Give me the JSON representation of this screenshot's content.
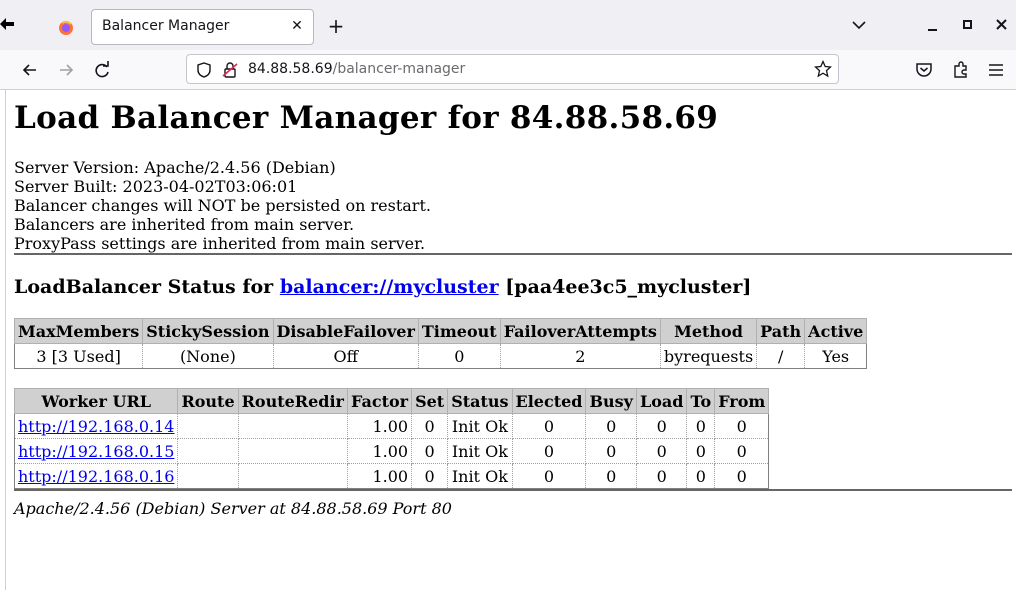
{
  "browser": {
    "tab_title": "Balancer Manager",
    "url_host": "84.88.58.69",
    "url_path": "/balancer-manager",
    "icons": [
      "firefox-icon",
      "close-icon",
      "plus-icon",
      "chevron-down-icon",
      "minimize-icon",
      "maximize-icon",
      "window-close-icon",
      "back-arrow-icon",
      "forward-arrow-icon",
      "reload-icon",
      "shield-icon",
      "lock-icon",
      "star-icon",
      "pocket-icon",
      "extensions-icon",
      "menu-icon"
    ]
  },
  "page": {
    "title": "Load Balancer Manager for 84.88.58.69",
    "info": [
      "Server Version: Apache/2.4.56 (Debian)",
      "Server Built: 2023-04-02T03:06:01",
      "Balancer changes will NOT be persisted on restart.",
      "Balancers are inherited from main server.",
      "ProxyPass settings are inherited from main server."
    ],
    "lb_prefix": "LoadBalancer Status for ",
    "lb_link": "balancer://mycluster",
    "lb_suffix": " [paa4ee3c5_mycluster]",
    "status_table": {
      "headers": [
        "MaxMembers",
        "StickySession",
        "DisableFailover",
        "Timeout",
        "FailoverAttempts",
        "Method",
        "Path",
        "Active"
      ],
      "row": [
        "3 [3 Used]",
        "(None)",
        "Off",
        "0",
        "2",
        "byrequests",
        "/",
        "Yes"
      ]
    },
    "worker_table": {
      "headers": [
        "Worker URL",
        "Route",
        "RouteRedir",
        "Factor",
        "Set",
        "Status",
        "Elected",
        "Busy",
        "Load",
        "To",
        "From"
      ],
      "rows": [
        [
          "http://192.168.0.14",
          "",
          "",
          "1.00",
          "0",
          "Init Ok",
          "0",
          "0",
          "0",
          "0",
          "0"
        ],
        [
          "http://192.168.0.15",
          "",
          "",
          "1.00",
          "0",
          "Init Ok",
          "0",
          "0",
          "0",
          "0",
          "0"
        ],
        [
          "http://192.168.0.16",
          "",
          "",
          "1.00",
          "0",
          "Init Ok",
          "0",
          "0",
          "0",
          "0",
          "0"
        ]
      ]
    },
    "footer": "Apache/2.4.56 (Debian) Server at 84.88.58.69 Port 80"
  }
}
